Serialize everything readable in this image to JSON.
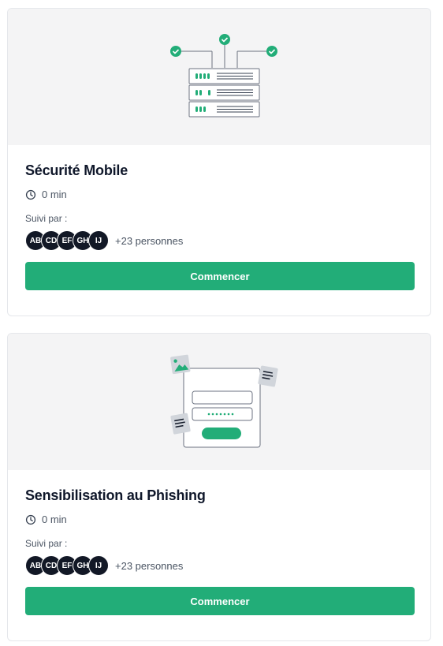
{
  "colors": {
    "accent": "#22ad78",
    "avatar_bg": "#121826",
    "illustration_bg": "#f4f4f5"
  },
  "courses": [
    {
      "title": "Sécurité Mobile",
      "illustration": "server-network-illustration",
      "duration": "0 min",
      "followed_label": "Suivi par :",
      "avatars": [
        "AB",
        "CD",
        "EF",
        "GH",
        "IJ"
      ],
      "more_count": "+23 personnes",
      "button_label": "Commencer"
    },
    {
      "title": "Sensibilisation au Phishing",
      "illustration": "login-form-illustration",
      "duration": "0 min",
      "followed_label": "Suivi par :",
      "avatars": [
        "AB",
        "CD",
        "EF",
        "GH",
        "IJ"
      ],
      "more_count": "+23 personnes",
      "button_label": "Commencer"
    }
  ]
}
